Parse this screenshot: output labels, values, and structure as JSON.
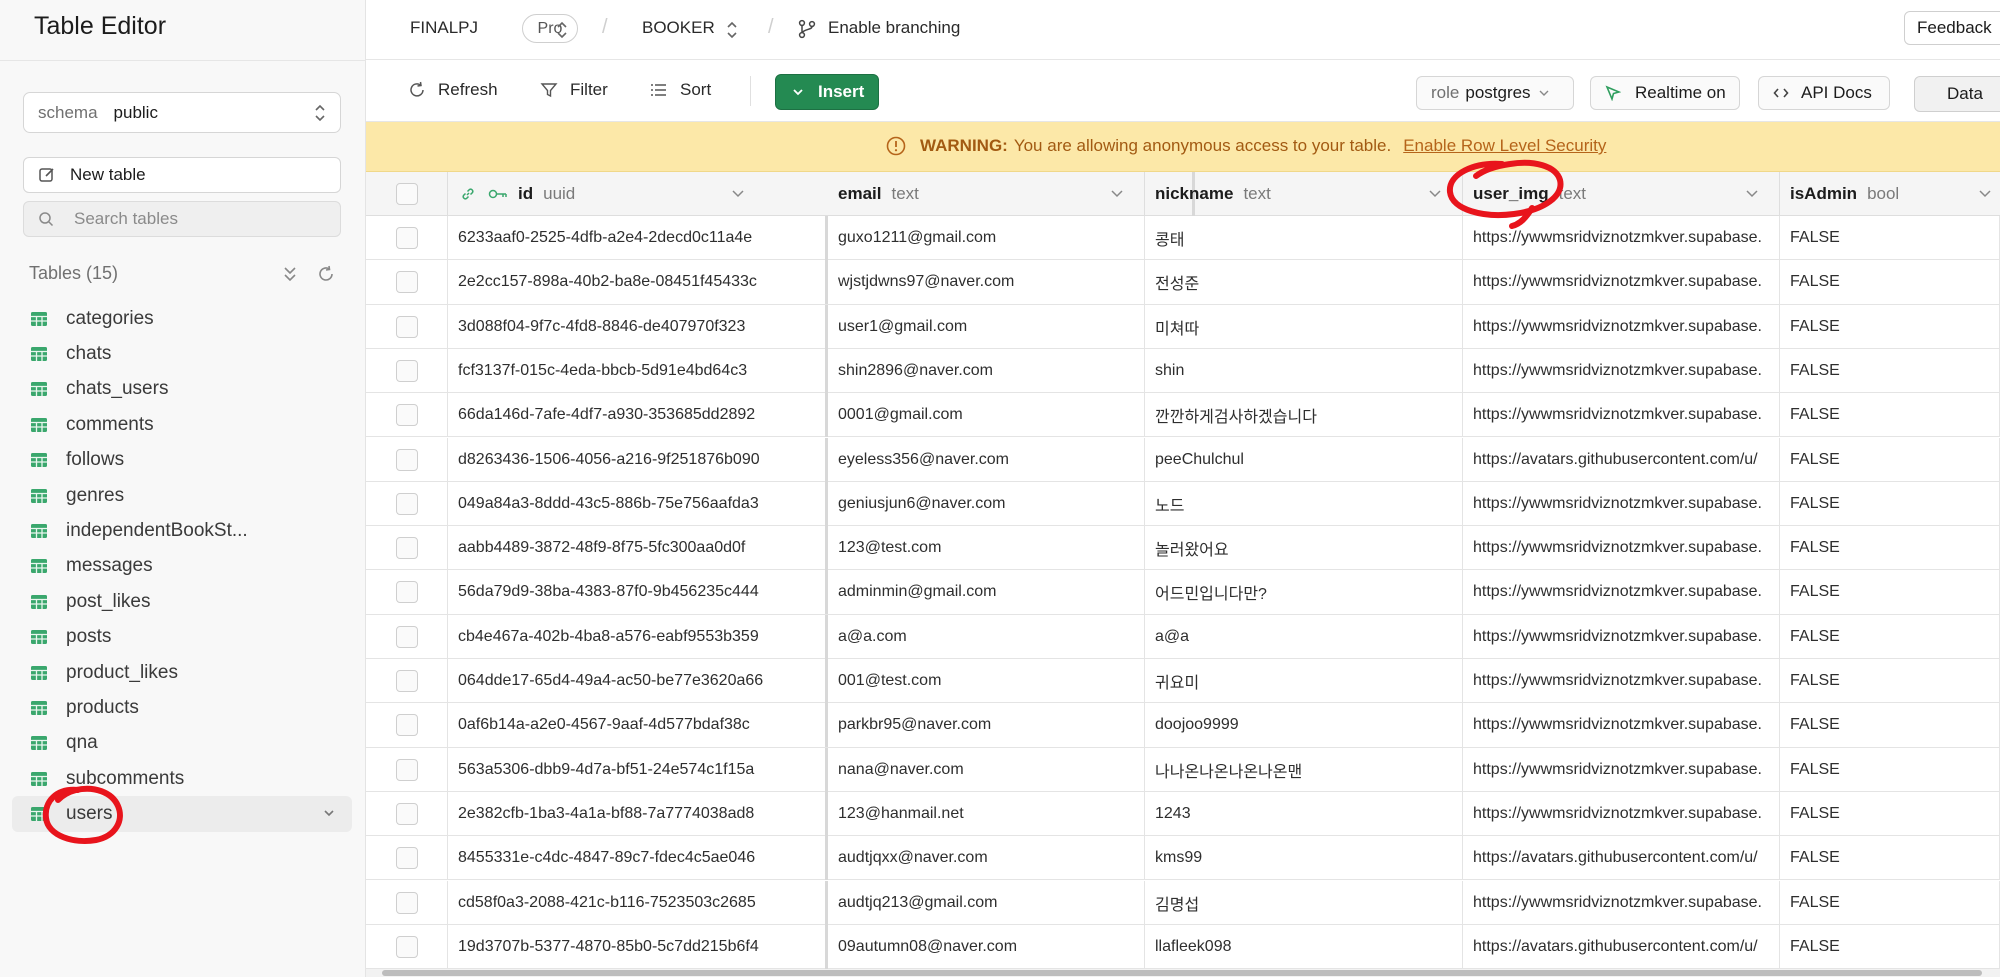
{
  "sidebar": {
    "title": "Table Editor",
    "schema": {
      "label": "schema",
      "value": "public"
    },
    "new_table_label": "New table",
    "search_placeholder": "Search tables",
    "tables_header": "Tables (15)",
    "tables": [
      {
        "label": "categories"
      },
      {
        "label": "chats"
      },
      {
        "label": "chats_users"
      },
      {
        "label": "comments"
      },
      {
        "label": "follows"
      },
      {
        "label": "genres"
      },
      {
        "label": "independentBookSt..."
      },
      {
        "label": "messages"
      },
      {
        "label": "post_likes"
      },
      {
        "label": "posts"
      },
      {
        "label": "product_likes"
      },
      {
        "label": "products"
      },
      {
        "label": "qna"
      },
      {
        "label": "subcomments"
      },
      {
        "label": "users"
      }
    ]
  },
  "topbar": {
    "project": "FINALPJ",
    "plan": "Pro",
    "branch": "BOOKER",
    "branching_label": "Enable branching",
    "feedback_label": "Feedback"
  },
  "toolbar": {
    "refresh_label": "Refresh",
    "filter_label": "Filter",
    "sort_label": "Sort",
    "insert_label": "Insert",
    "role_label": "role",
    "role_value": "postgres",
    "realtime_label": "Realtime on",
    "api_docs_label": "API Docs",
    "data_tab_label": "Data"
  },
  "warning": {
    "title": "WARNING:",
    "message": "You are allowing anonymous access to your table.",
    "link": "Enable Row Level Security"
  },
  "columns": [
    {
      "name": "id",
      "type": "uuid"
    },
    {
      "name": "email",
      "type": "text"
    },
    {
      "name": "nickname",
      "type": "text"
    },
    {
      "name": "user_img",
      "type": "text"
    },
    {
      "name": "isAdmin",
      "type": "bool"
    }
  ],
  "rows": [
    {
      "id": "6233aaf0-2525-4dfb-a2e4-2decd0c11a4e",
      "email": "guxo1211@gmail.com",
      "nickname": "콩태",
      "user_img": "https://ywwmsridviznotzmkver.supabase.",
      "isAdmin": "FALSE"
    },
    {
      "id": "2e2cc157-898a-40b2-ba8e-08451f45433c",
      "email": "wjstjdwns97@naver.com",
      "nickname": "전성준",
      "user_img": "https://ywwmsridviznotzmkver.supabase.",
      "isAdmin": "FALSE"
    },
    {
      "id": "3d088f04-9f7c-4fd8-8846-de407970f323",
      "email": "user1@gmail.com",
      "nickname": "미쳐따",
      "user_img": "https://ywwmsridviznotzmkver.supabase.",
      "isAdmin": "FALSE"
    },
    {
      "id": "fcf3137f-015c-4eda-bbcb-5d91e4bd64c3",
      "email": "shin2896@naver.com",
      "nickname": "shin",
      "user_img": "https://ywwmsridviznotzmkver.supabase.",
      "isAdmin": "FALSE"
    },
    {
      "id": "66da146d-7afe-4df7-a930-353685dd2892",
      "email": "0001@gmail.com",
      "nickname": "깐깐하게검사하겠습니다",
      "user_img": "https://ywwmsridviznotzmkver.supabase.",
      "isAdmin": "FALSE"
    },
    {
      "id": "d8263436-1506-4056-a216-9f251876b090",
      "email": "eyeless356@naver.com",
      "nickname": "peeChulchul",
      "user_img": "https://avatars.githubusercontent.com/u/",
      "isAdmin": "FALSE"
    },
    {
      "id": "049a84a3-8ddd-43c5-886b-75e756aafda3",
      "email": "geniusjun6@naver.com",
      "nickname": "노드",
      "user_img": "https://ywwmsridviznotzmkver.supabase.",
      "isAdmin": "FALSE"
    },
    {
      "id": "aabb4489-3872-48f9-8f75-5fc300aa0d0f",
      "email": "123@test.com",
      "nickname": "놀러왔어요",
      "user_img": "https://ywwmsridviznotzmkver.supabase.",
      "isAdmin": "FALSE"
    },
    {
      "id": "56da79d9-38ba-4383-87f0-9b456235c444",
      "email": "adminmin@gmail.com",
      "nickname": "어드민입니다만?",
      "user_img": "https://ywwmsridviznotzmkver.supabase.",
      "isAdmin": "FALSE"
    },
    {
      "id": "cb4e467a-402b-4ba8-a576-eabf9553b359",
      "email": "a@a.com",
      "nickname": "a@a",
      "user_img": "https://ywwmsridviznotzmkver.supabase.",
      "isAdmin": "FALSE"
    },
    {
      "id": "064dde17-65d4-49a4-ac50-be77e3620a66",
      "email": "001@test.com",
      "nickname": "귀요미",
      "user_img": "https://ywwmsridviznotzmkver.supabase.",
      "isAdmin": "FALSE"
    },
    {
      "id": "0af6b14a-a2e0-4567-9aaf-4d577bdaf38c",
      "email": "parkbr95@naver.com",
      "nickname": "doojoo9999",
      "user_img": "https://ywwmsridviznotzmkver.supabase.",
      "isAdmin": "FALSE"
    },
    {
      "id": "563a5306-dbb9-4d7a-bf51-24e574c1f15a",
      "email": "nana@naver.com",
      "nickname": "나나온나온나온나온맨",
      "user_img": "https://ywwmsridviznotzmkver.supabase.",
      "isAdmin": "FALSE"
    },
    {
      "id": "2e382cfb-1ba3-4a1a-bf88-7a7774038ad8",
      "email": "123@hanmail.net",
      "nickname": "1243",
      "user_img": "https://ywwmsridviznotzmkver.supabase.",
      "isAdmin": "FALSE"
    },
    {
      "id": "8455331e-c4dc-4847-89c7-fdec4c5ae046",
      "email": "audtjqxx@naver.com",
      "nickname": "kms99",
      "user_img": "https://avatars.githubusercontent.com/u/",
      "isAdmin": "FALSE"
    },
    {
      "id": "cd58f0a3-2088-421c-b116-7523503c2685",
      "email": "audtjq213@gmail.com",
      "nickname": "김명섭",
      "user_img": "https://ywwmsridviznotzmkver.supabase.",
      "isAdmin": "FALSE"
    },
    {
      "id": "19d3707b-5377-4870-85b0-5c7dd215b6f4",
      "email": "09autumn08@naver.com",
      "nickname": "llafleek098",
      "user_img": "https://avatars.githubusercontent.com/u/",
      "isAdmin": "FALSE"
    }
  ],
  "colors": {
    "accent_green": "#248a52",
    "warning_bg": "#fce8a8",
    "warning_text": "#a25a12",
    "annotation_red": "#e8141c"
  }
}
